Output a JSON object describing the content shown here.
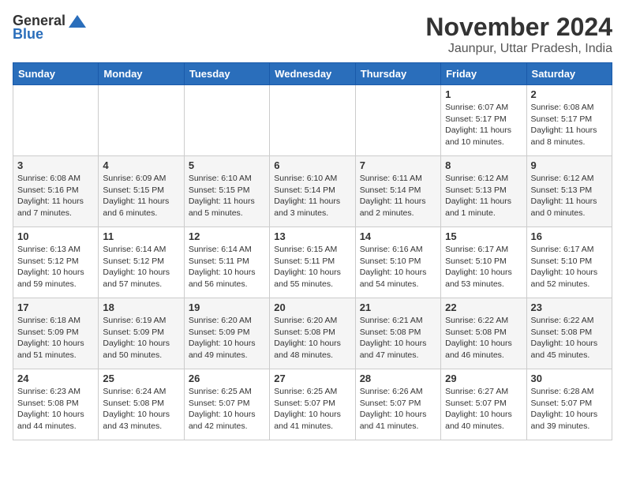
{
  "logo": {
    "general": "General",
    "blue": "Blue"
  },
  "title": "November 2024",
  "location": "Jaunpur, Uttar Pradesh, India",
  "headers": [
    "Sunday",
    "Monday",
    "Tuesday",
    "Wednesday",
    "Thursday",
    "Friday",
    "Saturday"
  ],
  "weeks": [
    [
      {
        "day": "",
        "info": ""
      },
      {
        "day": "",
        "info": ""
      },
      {
        "day": "",
        "info": ""
      },
      {
        "day": "",
        "info": ""
      },
      {
        "day": "",
        "info": ""
      },
      {
        "day": "1",
        "info": "Sunrise: 6:07 AM\nSunset: 5:17 PM\nDaylight: 11 hours and 10 minutes."
      },
      {
        "day": "2",
        "info": "Sunrise: 6:08 AM\nSunset: 5:17 PM\nDaylight: 11 hours and 8 minutes."
      }
    ],
    [
      {
        "day": "3",
        "info": "Sunrise: 6:08 AM\nSunset: 5:16 PM\nDaylight: 11 hours and 7 minutes."
      },
      {
        "day": "4",
        "info": "Sunrise: 6:09 AM\nSunset: 5:15 PM\nDaylight: 11 hours and 6 minutes."
      },
      {
        "day": "5",
        "info": "Sunrise: 6:10 AM\nSunset: 5:15 PM\nDaylight: 11 hours and 5 minutes."
      },
      {
        "day": "6",
        "info": "Sunrise: 6:10 AM\nSunset: 5:14 PM\nDaylight: 11 hours and 3 minutes."
      },
      {
        "day": "7",
        "info": "Sunrise: 6:11 AM\nSunset: 5:14 PM\nDaylight: 11 hours and 2 minutes."
      },
      {
        "day": "8",
        "info": "Sunrise: 6:12 AM\nSunset: 5:13 PM\nDaylight: 11 hours and 1 minute."
      },
      {
        "day": "9",
        "info": "Sunrise: 6:12 AM\nSunset: 5:13 PM\nDaylight: 11 hours and 0 minutes."
      }
    ],
    [
      {
        "day": "10",
        "info": "Sunrise: 6:13 AM\nSunset: 5:12 PM\nDaylight: 10 hours and 59 minutes."
      },
      {
        "day": "11",
        "info": "Sunrise: 6:14 AM\nSunset: 5:12 PM\nDaylight: 10 hours and 57 minutes."
      },
      {
        "day": "12",
        "info": "Sunrise: 6:14 AM\nSunset: 5:11 PM\nDaylight: 10 hours and 56 minutes."
      },
      {
        "day": "13",
        "info": "Sunrise: 6:15 AM\nSunset: 5:11 PM\nDaylight: 10 hours and 55 minutes."
      },
      {
        "day": "14",
        "info": "Sunrise: 6:16 AM\nSunset: 5:10 PM\nDaylight: 10 hours and 54 minutes."
      },
      {
        "day": "15",
        "info": "Sunrise: 6:17 AM\nSunset: 5:10 PM\nDaylight: 10 hours and 53 minutes."
      },
      {
        "day": "16",
        "info": "Sunrise: 6:17 AM\nSunset: 5:10 PM\nDaylight: 10 hours and 52 minutes."
      }
    ],
    [
      {
        "day": "17",
        "info": "Sunrise: 6:18 AM\nSunset: 5:09 PM\nDaylight: 10 hours and 51 minutes."
      },
      {
        "day": "18",
        "info": "Sunrise: 6:19 AM\nSunset: 5:09 PM\nDaylight: 10 hours and 50 minutes."
      },
      {
        "day": "19",
        "info": "Sunrise: 6:20 AM\nSunset: 5:09 PM\nDaylight: 10 hours and 49 minutes."
      },
      {
        "day": "20",
        "info": "Sunrise: 6:20 AM\nSunset: 5:08 PM\nDaylight: 10 hours and 48 minutes."
      },
      {
        "day": "21",
        "info": "Sunrise: 6:21 AM\nSunset: 5:08 PM\nDaylight: 10 hours and 47 minutes."
      },
      {
        "day": "22",
        "info": "Sunrise: 6:22 AM\nSunset: 5:08 PM\nDaylight: 10 hours and 46 minutes."
      },
      {
        "day": "23",
        "info": "Sunrise: 6:22 AM\nSunset: 5:08 PM\nDaylight: 10 hours and 45 minutes."
      }
    ],
    [
      {
        "day": "24",
        "info": "Sunrise: 6:23 AM\nSunset: 5:08 PM\nDaylight: 10 hours and 44 minutes."
      },
      {
        "day": "25",
        "info": "Sunrise: 6:24 AM\nSunset: 5:08 PM\nDaylight: 10 hours and 43 minutes."
      },
      {
        "day": "26",
        "info": "Sunrise: 6:25 AM\nSunset: 5:07 PM\nDaylight: 10 hours and 42 minutes."
      },
      {
        "day": "27",
        "info": "Sunrise: 6:25 AM\nSunset: 5:07 PM\nDaylight: 10 hours and 41 minutes."
      },
      {
        "day": "28",
        "info": "Sunrise: 6:26 AM\nSunset: 5:07 PM\nDaylight: 10 hours and 41 minutes."
      },
      {
        "day": "29",
        "info": "Sunrise: 6:27 AM\nSunset: 5:07 PM\nDaylight: 10 hours and 40 minutes."
      },
      {
        "day": "30",
        "info": "Sunrise: 6:28 AM\nSunset: 5:07 PM\nDaylight: 10 hours and 39 minutes."
      }
    ]
  ]
}
